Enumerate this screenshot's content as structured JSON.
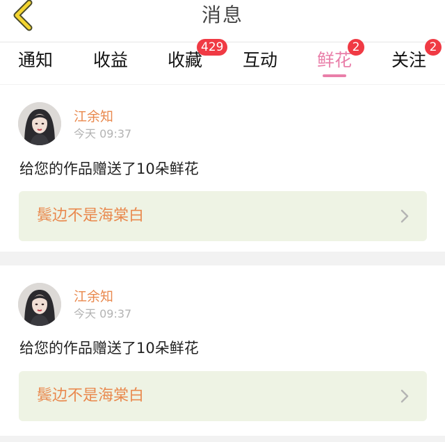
{
  "header": {
    "title": "消息",
    "back_icon": "chevron-left-icon",
    "back_color": "#f4d531"
  },
  "tabs": [
    {
      "label": "通知",
      "badge": ""
    },
    {
      "label": "收益",
      "badge": ""
    },
    {
      "label": "收藏",
      "badge": "429"
    },
    {
      "label": "互动",
      "badge": ""
    },
    {
      "label": "鲜花",
      "badge": "2",
      "active": true
    },
    {
      "label": "关注",
      "badge": "2"
    }
  ],
  "colors": {
    "accent_pink": "#e97fa9",
    "badge_red": "#f03a44",
    "name_orange": "#e9894e",
    "work_box_bg": "#eef3e4"
  },
  "messages": [
    {
      "username": "江余知",
      "time": "今天 09:37",
      "text": "给您的作品赠送了10朵鲜花",
      "work_title": "鬓边不是海棠白",
      "arrow_icon": "chevron-right-icon"
    },
    {
      "username": "江余知",
      "time": "今天 09:37",
      "text": "给您的作品赠送了10朵鲜花",
      "work_title": "鬓边不是海棠白",
      "arrow_icon": "chevron-right-icon"
    }
  ]
}
